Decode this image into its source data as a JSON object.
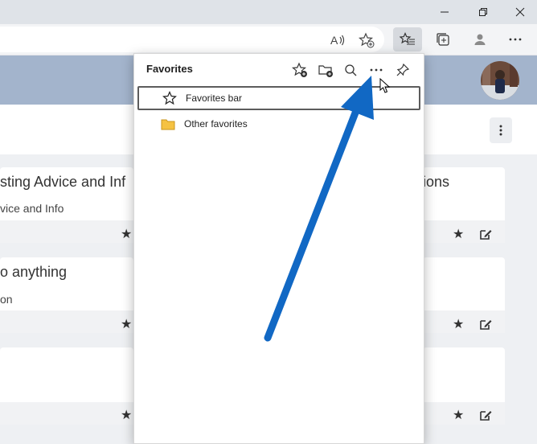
{
  "window": {
    "minimize_icon": "minimize-icon",
    "restore_icon": "restore-icon",
    "close_icon": "close-icon"
  },
  "toolbar": {
    "icons": [
      "read-aloud-icon",
      "add-favorite-icon",
      "favorites-icon",
      "collections-icon",
      "profile-icon",
      "more-icon"
    ]
  },
  "page": {
    "cards": [
      {
        "title": "sting Advice and Inf",
        "subtitle": "vice and Info"
      },
      {
        "title": "ions",
        "subtitle": ""
      },
      {
        "title": "o anything",
        "subtitle": "on"
      },
      {
        "title": "",
        "subtitle": ""
      }
    ]
  },
  "favorites": {
    "title": "Favorites",
    "toolbar_icons": [
      "add-page-icon",
      "add-folder-icon",
      "search-icon",
      "more-options-icon",
      "pin-icon"
    ],
    "items": [
      {
        "label": "Favorites bar",
        "icon": "star-outline-icon",
        "selected": true
      },
      {
        "label": "Other favorites",
        "icon": "folder-icon",
        "selected": false
      }
    ]
  },
  "colors": {
    "header": "#a3b4cc",
    "arrow": "#1168c4",
    "folder": "#f5c242"
  }
}
